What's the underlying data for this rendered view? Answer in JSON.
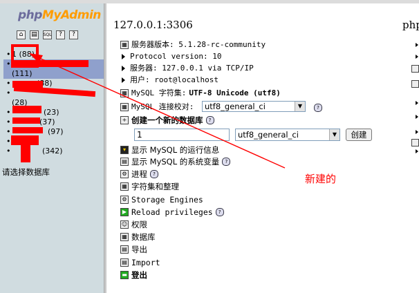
{
  "sidebar": {
    "logo_part1": "php",
    "logo_part2": "MyAdmin",
    "db_items": [
      {
        "label": "1 (88)"
      },
      {
        "label": "(111)"
      },
      {
        "label": "(88)"
      },
      {
        "label": "(28)"
      },
      {
        "label": "(23)"
      },
      {
        "label": "(37)"
      },
      {
        "label": "(97)"
      },
      {
        "label": "(342)"
      }
    ],
    "status": "请选择数据库"
  },
  "main": {
    "host": "127.0.0.1:3306",
    "php_heading": "php",
    "server_info": [
      {
        "label": "服务器版本: 5.1.28-rc-community"
      },
      {
        "label": "Protocol version: 10"
      },
      {
        "label": "服务器: 127.0.0.1 via TCP/IP"
      },
      {
        "label": "用户: root@localhost"
      }
    ],
    "charset_label": "MySQL 字符集: ",
    "charset_value": "UTF-8 Unicode (utf8)",
    "collation_label": "MySQL 连接校对:",
    "collation_value": "utf8_general_ci",
    "create_db_label": "创建一个新的数据库",
    "create_db_name_value": "1",
    "create_db_collation": "utf8_general_ci",
    "create_button": "创建",
    "links": [
      {
        "label": "显示 MySQL 的运行信息"
      },
      {
        "label": "显示 MySQL 的系统变量"
      },
      {
        "label": "进程"
      },
      {
        "label": "字符集和整理"
      },
      {
        "label": "Storage Engines"
      },
      {
        "label": "Reload privileges"
      },
      {
        "label": "权限"
      },
      {
        "label": "数据库"
      },
      {
        "label": "导出"
      },
      {
        "label": "Import"
      },
      {
        "label": "登出"
      }
    ]
  },
  "annotation": {
    "text": "新建的",
    "color": "#ff0000"
  },
  "colors": {
    "sidebar_bg": "#d0dce0",
    "selected_row": "#8fa0cc",
    "logo_php": "#6c6c9c",
    "logo_admin": "#ff9c00"
  }
}
